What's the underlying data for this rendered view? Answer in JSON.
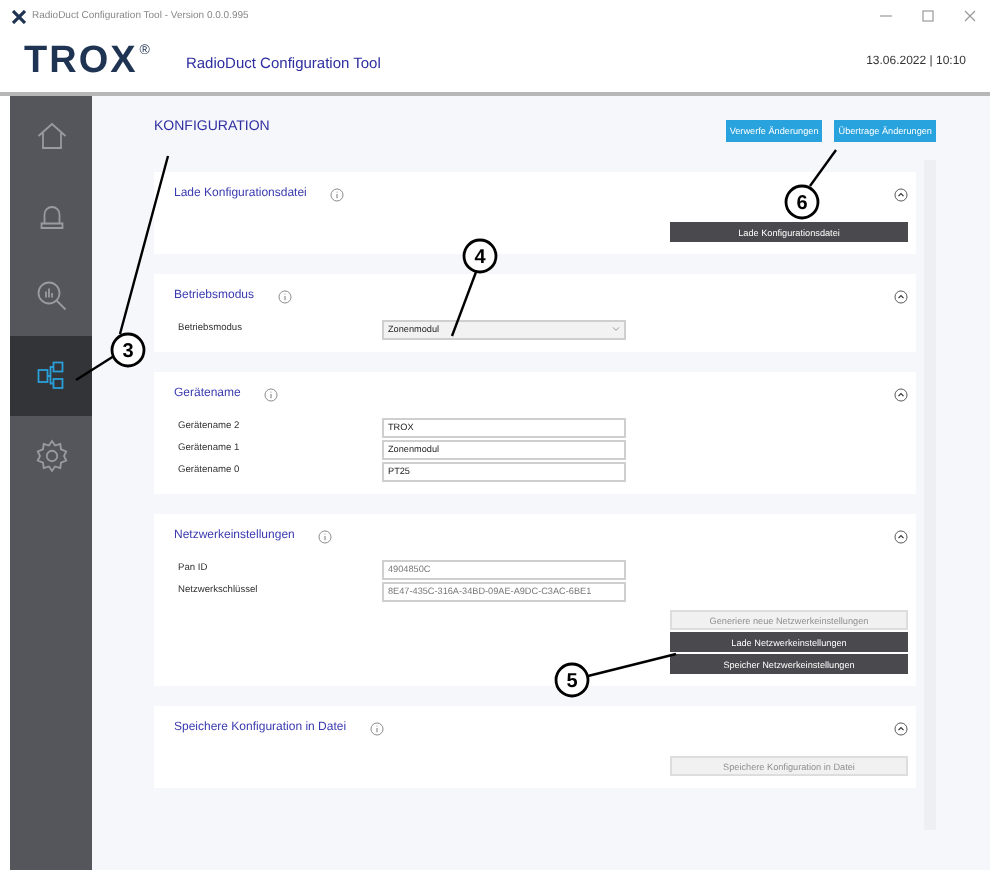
{
  "window": {
    "title": "RadioDuct Configuration Tool - Version 0.0.0.995"
  },
  "header": {
    "logo": "TROX",
    "logo_mark": "®",
    "app_title": "RadioDuct Configuration Tool",
    "datetime": "13.06.2022 | 10:10"
  },
  "sidebar": {
    "items": [
      {
        "kind": "home",
        "selected": false
      },
      {
        "kind": "alarm",
        "selected": false
      },
      {
        "kind": "analysis",
        "selected": false
      },
      {
        "kind": "configuration",
        "selected": true
      },
      {
        "kind": "settings",
        "selected": false
      }
    ]
  },
  "page": {
    "title": "KONFIGURATION",
    "buttons": [
      "Verwerfe Änderungen",
      "Übertrage Änderungen"
    ]
  },
  "sections": [
    {
      "title": "Lade Konfigurationsdatei",
      "expanded": true,
      "buttons": [
        {
          "label": "Lade Konfigurationsdatei",
          "disabled": false
        }
      ]
    },
    {
      "title": "Betriebsmodus",
      "expanded": true,
      "fields": [
        {
          "label": "Betriebsmodus",
          "value": "Zonenmodul",
          "kind": "select",
          "disabled": false
        }
      ]
    },
    {
      "title": "Gerätename",
      "expanded": true,
      "fields": [
        {
          "label": "Gerätename 2",
          "value": "TROX",
          "kind": "text",
          "disabled": false
        },
        {
          "label": "Gerätename 1",
          "value": "Zonenmodul",
          "kind": "text",
          "disabled": false
        },
        {
          "label": "Gerätename 0",
          "value": "PT25",
          "kind": "text",
          "disabled": false
        }
      ]
    },
    {
      "title": "Netzwerkeinstellungen",
      "expanded": true,
      "fields": [
        {
          "label": "Pan ID",
          "value": "4904850C",
          "kind": "text",
          "disabled": true
        },
        {
          "label": "Netzwerkschlüssel",
          "value": "8E47-435C-316A-34BD-09AE-A9DC-C3AC-6BE1",
          "kind": "text",
          "disabled": true
        }
      ],
      "buttons": [
        {
          "label": "Generiere neue Netzwerkeinstellungen",
          "disabled": true
        },
        {
          "label": "Lade Netzwerkeinstellungen",
          "disabled": false
        },
        {
          "label": "Speicher Netzwerkeinstellungen",
          "disabled": false
        }
      ]
    },
    {
      "title": "Speichere Konfiguration in Datei",
      "expanded": true,
      "buttons": [
        {
          "label": "Speichere Konfiguration in Datei",
          "disabled": true
        }
      ]
    }
  ],
  "callouts": [
    {
      "number": "3"
    },
    {
      "number": "4"
    },
    {
      "number": "5"
    },
    {
      "number": "6"
    }
  ]
}
